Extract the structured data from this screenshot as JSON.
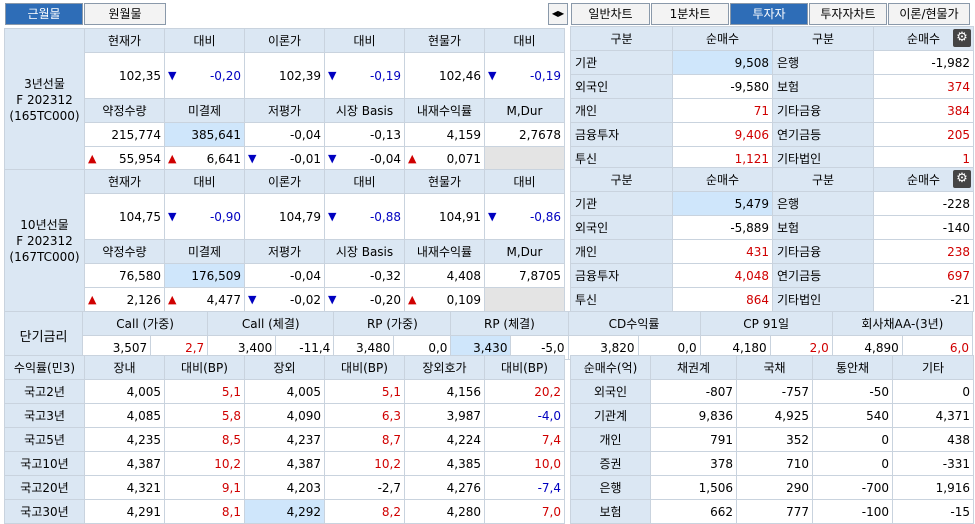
{
  "tabs_left": [
    "근월물",
    "원월물"
  ],
  "tabs_right": [
    "일반차트",
    "1분차트",
    "투자자",
    "투자자차트",
    "이론/현물가"
  ],
  "scroll_icon": "◀▶",
  "fut_headers1": [
    "현재가",
    "대비",
    "이론가",
    "대비",
    "현물가",
    "대비"
  ],
  "fut_headers2": [
    "약정수량",
    "미결제",
    "저평가",
    "시장 Basis",
    "내재수익률",
    "M,Dur"
  ],
  "f3": {
    "name1": "3년선물",
    "name2": "F 202312",
    "name3": "(165TC000)",
    "r1": [
      "102,35",
      "-0,20",
      "102,39",
      "-0,19",
      "102,46",
      "-0,19"
    ],
    "r2": [
      "215,774",
      "385,641",
      "-0,04",
      "-0,13",
      "4,159",
      "2,7678"
    ],
    "r3": [
      "55,954",
      "6,641",
      "-0,01",
      "-0,04",
      "0,071"
    ]
  },
  "f10": {
    "name1": "10년선물",
    "name2": "F 202312",
    "name3": "(167TC000)",
    "r1": [
      "104,75",
      "-0,90",
      "104,79",
      "-0,88",
      "104,91",
      "-0,86"
    ],
    "r2": [
      "76,580",
      "176,509",
      "-0,04",
      "-0,32",
      "4,408",
      "7,8705"
    ],
    "r3": [
      "2,126",
      "4,477",
      "-0,02",
      "-0,20",
      "0,109"
    ]
  },
  "inv_headers": [
    "구분",
    "순매수",
    "구분",
    "순매수"
  ],
  "inv1": [
    [
      "기관",
      "9,508",
      "은행",
      "-1,982"
    ],
    [
      "외국인",
      "-9,580",
      "보험",
      "374"
    ],
    [
      "개인",
      "71",
      "기타금융",
      "384"
    ],
    [
      "금융투자",
      "9,406",
      "연기금등",
      "205"
    ],
    [
      "투신",
      "1,121",
      "기타법인",
      "1"
    ]
  ],
  "inv2": [
    [
      "기관",
      "5,479",
      "은행",
      "-228"
    ],
    [
      "외국인",
      "-5,889",
      "보험",
      "-140"
    ],
    [
      "개인",
      "431",
      "기타금융",
      "238"
    ],
    [
      "금융투자",
      "4,048",
      "연기금등",
      "697"
    ],
    [
      "투신",
      "864",
      "기타법인",
      "-21"
    ]
  ],
  "short_label": "단기금리",
  "short_headers": [
    "Call (가중)",
    "Call (체결)",
    "RP (가중)",
    "RP (체결)",
    "CD수익률",
    "CP 91일",
    "회사채AA-(3년)"
  ],
  "short_vals": [
    "3,507",
    "2,7",
    "3,400",
    "-11,4",
    "3,480",
    "0,0",
    "3,430",
    "-5,0",
    "3,820",
    "0,0",
    "4,180",
    "2,0",
    "4,890",
    "6,0"
  ],
  "yield_headers": [
    "수익률(민3)",
    "장내",
    "대비(BP)",
    "장외",
    "대비(BP)",
    "장외호가",
    "대비(BP)"
  ],
  "yields": [
    [
      "국고2년",
      "4,005",
      "5,1",
      "4,005",
      "5,1",
      "4,156",
      "20,2"
    ],
    [
      "국고3년",
      "4,085",
      "5,8",
      "4,090",
      "6,3",
      "3,987",
      "-4,0"
    ],
    [
      "국고5년",
      "4,235",
      "8,5",
      "4,237",
      "8,7",
      "4,224",
      "7,4"
    ],
    [
      "국고10년",
      "4,387",
      "10,2",
      "4,387",
      "10,2",
      "4,385",
      "10,0"
    ],
    [
      "국고20년",
      "4,321",
      "9,1",
      "4,203",
      "-2,7",
      "4,276",
      "-7,4"
    ],
    [
      "국고30년",
      "4,291",
      "8,1",
      "4,292",
      "8,2",
      "4,280",
      "7,0"
    ]
  ],
  "net_headers": [
    "순매수(억)",
    "채권계",
    "국채",
    "통안채",
    "기타"
  ],
  "nets": [
    [
      "외국인",
      "-807",
      "-757",
      "-50",
      "0"
    ],
    [
      "기관계",
      "9,836",
      "4,925",
      "540",
      "4,371"
    ],
    [
      "개인",
      "791",
      "352",
      "0",
      "438"
    ],
    [
      "증권",
      "378",
      "710",
      "0",
      "-331"
    ],
    [
      "은행",
      "1,506",
      "290",
      "-700",
      "1,916"
    ],
    [
      "보험",
      "662",
      "777",
      "-100",
      "-15"
    ]
  ]
}
